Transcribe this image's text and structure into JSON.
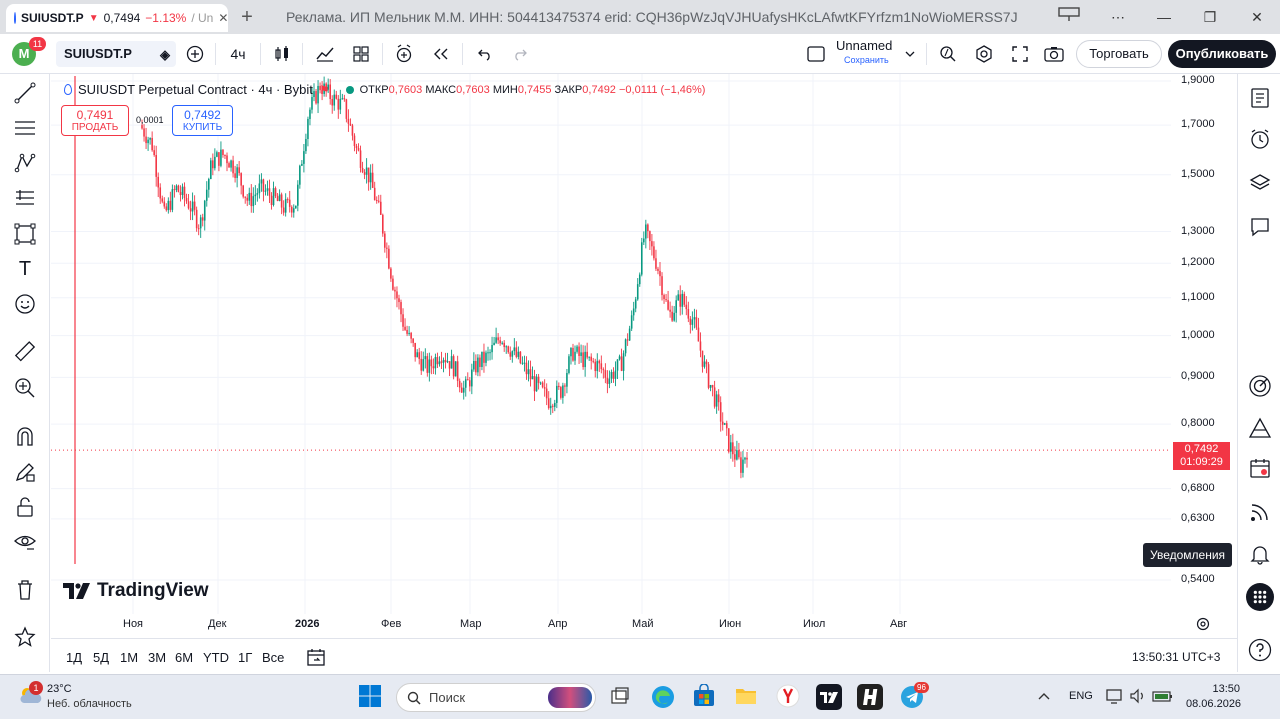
{
  "browser": {
    "tab_symbol": "SUIUSDT.P",
    "tab_arrow": "▼",
    "tab_price": "0,7494",
    "tab_change": "−1.13%",
    "tab_fade": "/ Un",
    "new_tab": "+",
    "ad_text": "Реклама. ИП Мельник М.М. ИНН: 504413475374 erid: CQH36pWzJqVJHUafysHKcLAfwtKFYrfzm1NoWioMERSS7J",
    "window_buttons": [
      "⋯",
      "—",
      "❐",
      "✕"
    ]
  },
  "toolbar": {
    "avatar_letter": "M",
    "avatar_badge": "11",
    "symbol": "SUIUSDT.P",
    "timeframe": "4ч",
    "layout_name": "Unnamed",
    "layout_save": "Сохранить",
    "trade_label": "Торговать",
    "publish_label": "Опубликовать"
  },
  "legend": {
    "title": "SUIUSDT Perpetual Contract · 4ч · Bybit",
    "open_label": "ОТКР",
    "open": "0,7603",
    "high_label": "МАКС",
    "high": "0,7603",
    "low_label": "МИН",
    "low": "0,7455",
    "close_label": "ЗАКР",
    "close": "0,7492",
    "change": "−0,0111 (−1,46%)",
    "sell_price": "0,7491",
    "sell_label": "ПРОДАТЬ",
    "spread": "0,0001",
    "buy_price": "0,7492",
    "buy_label": "КУПИТЬ"
  },
  "chart_data": {
    "type": "candlestick",
    "title": "SUIUSDT Perpetual Contract · 4ч · Bybit",
    "y_scale": "log",
    "ylim": [
      0.52,
      1.95
    ],
    "y_ticks": [
      "1,9000",
      "1,7000",
      "1,5000",
      "1,3000",
      "1,2000",
      "1,1000",
      "1,0000",
      "0,9000",
      "0,8000",
      "0,6800",
      "0,6300",
      "0,5400"
    ],
    "y_tick_values": [
      1.9,
      1.7,
      1.5,
      1.3,
      1.2,
      1.1,
      1.0,
      0.9,
      0.8,
      0.68,
      0.63,
      0.54
    ],
    "x_ticks": [
      "Ноя",
      "Дек",
      "2026",
      "Фев",
      "Мар",
      "Апр",
      "Май",
      "Июн",
      "Июл",
      "Авг"
    ],
    "current_price": "0,7492",
    "countdown": "01:09:29",
    "approx_close_path": [
      [
        0,
        1.7
      ],
      [
        2,
        1.62
      ],
      [
        4,
        1.35
      ],
      [
        6,
        1.45
      ],
      [
        8,
        1.4
      ],
      [
        10,
        1.32
      ],
      [
        12,
        1.55
      ],
      [
        14,
        1.58
      ],
      [
        16,
        1.52
      ],
      [
        18,
        1.4
      ],
      [
        20,
        1.45
      ],
      [
        22,
        1.42
      ],
      [
        24,
        1.38
      ],
      [
        26,
        1.4
      ],
      [
        28,
        1.75
      ],
      [
        30,
        1.88
      ],
      [
        32,
        1.82
      ],
      [
        34,
        1.78
      ],
      [
        36,
        1.6
      ],
      [
        38,
        1.5
      ],
      [
        40,
        1.35
      ],
      [
        42,
        1.15
      ],
      [
        44,
        1.02
      ],
      [
        46,
        0.95
      ],
      [
        48,
        0.92
      ],
      [
        50,
        0.96
      ],
      [
        52,
        0.93
      ],
      [
        54,
        0.87
      ],
      [
        56,
        0.93
      ],
      [
        58,
        0.95
      ],
      [
        60,
        1.0
      ],
      [
        62,
        0.96
      ],
      [
        64,
        0.92
      ],
      [
        66,
        0.88
      ],
      [
        68,
        0.85
      ],
      [
        70,
        0.87
      ],
      [
        72,
        0.96
      ],
      [
        74,
        0.94
      ],
      [
        76,
        0.93
      ],
      [
        78,
        0.9
      ],
      [
        80,
        0.93
      ],
      [
        82,
        1.05
      ],
      [
        84,
        1.3
      ],
      [
        86,
        1.2
      ],
      [
        88,
        1.05
      ],
      [
        90,
        1.1
      ],
      [
        92,
        1.04
      ],
      [
        94,
        0.92
      ],
      [
        96,
        0.84
      ],
      [
        98,
        0.76
      ],
      [
        100,
        0.72
      ],
      [
        101,
        0.75
      ]
    ]
  },
  "time_axis": {
    "ranges": [
      "1Д",
      "5Д",
      "1М",
      "3М",
      "6М",
      "YTD",
      "1Г",
      "Все"
    ],
    "clock": "13:50:31 UTC+3"
  },
  "branding": {
    "logo_text": "TradingView"
  },
  "tooltip": {
    "notifications": "Уведомления"
  },
  "taskbar": {
    "weather_badge": "1",
    "temp": "23°C",
    "weather_desc": "Неб. облачность",
    "search_placeholder": "Поиск",
    "lang": "ENG",
    "time": "13:50",
    "date": "08.06.2026",
    "telegram_badge": "96",
    "colors": {
      "taskbar_bg": "#e6eaf2"
    }
  },
  "colors": {
    "up": "#089981",
    "down": "#f23645",
    "accent": "#2962ff"
  }
}
